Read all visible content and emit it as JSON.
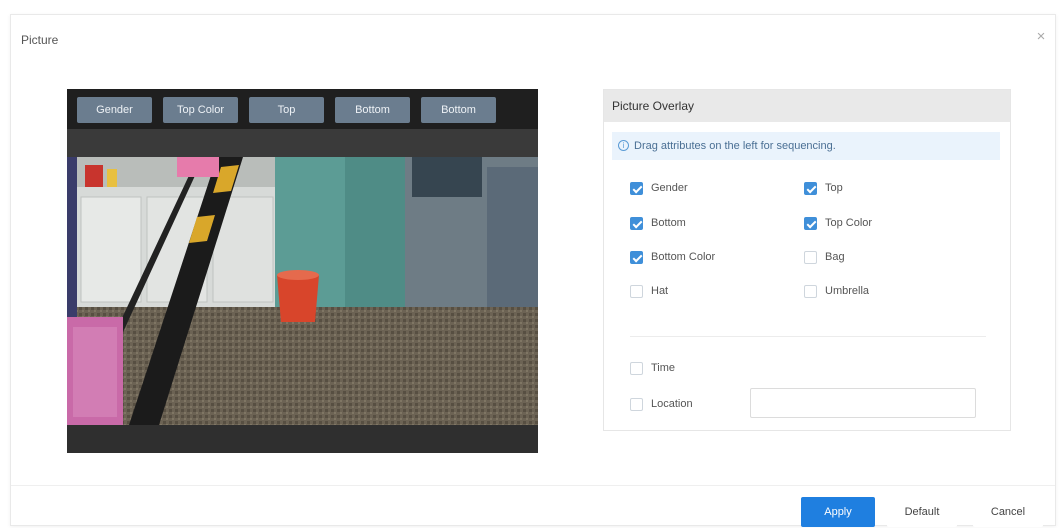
{
  "dialog": {
    "title": "Picture",
    "close_glyph": "×"
  },
  "preview": {
    "attribute_chips": [
      "Gender",
      "Top Color",
      "Top",
      "Bottom",
      "Bottom"
    ]
  },
  "overlay": {
    "header": "Picture Overlay",
    "tip": "Drag attributes on the left for sequencing.",
    "attributes": [
      {
        "label": "Gender",
        "checked": true
      },
      {
        "label": "Top",
        "checked": true
      },
      {
        "label": "Bottom",
        "checked": true
      },
      {
        "label": "Top Color",
        "checked": true
      },
      {
        "label": "Bottom Color",
        "checked": true
      },
      {
        "label": "Bag",
        "checked": false
      },
      {
        "label": "Hat",
        "checked": false
      },
      {
        "label": "Umbrella",
        "checked": false
      }
    ],
    "time_label": "Time",
    "time_checked": false,
    "location_label": "Location",
    "location_checked": false,
    "location_value": ""
  },
  "footer": {
    "apply": "Apply",
    "default": "Default",
    "cancel": "Cancel"
  },
  "colors": {
    "primary": "#1f7fe0",
    "checkbox_checked": "#3f8fd9",
    "chip": "#6b7d8f",
    "tip_bg": "#eaf3fc"
  }
}
